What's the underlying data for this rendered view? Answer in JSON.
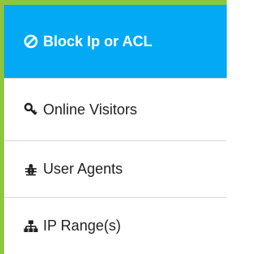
{
  "menu": {
    "items": [
      {
        "label": "Block Ip or ACL",
        "icon": "ban-icon",
        "active": true
      },
      {
        "label": "Online Visitors",
        "icon": "key-icon",
        "active": false
      },
      {
        "label": "User Agents",
        "icon": "bug-icon",
        "active": false
      },
      {
        "label": "IP Range(s)",
        "icon": "sitemap-icon",
        "active": false
      }
    ]
  },
  "colors": {
    "active_bg": "#03a9f4",
    "frame": "#8cc63f",
    "divider": "#d8d8d8",
    "text": "#222222"
  }
}
